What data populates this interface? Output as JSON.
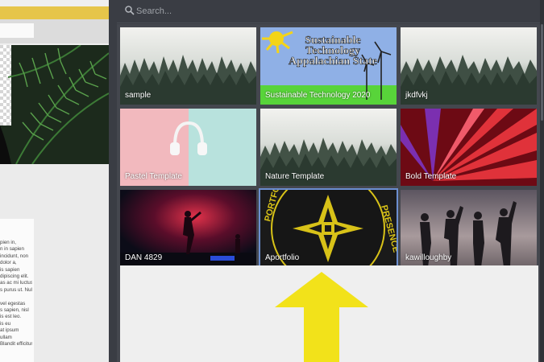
{
  "search": {
    "placeholder": "Search..."
  },
  "left_pane": {
    "body_text": "pien in,\nn in sapien\nincidunt, non\ndolor a,\nis sapien\ndipiscing elit.\nas ac mi luctus\ns purus ut. Nulla\n\nvel egestas\ns sapien, nisl\nis est leo.\nis eu\nat ipsum\nullam\nBlandit efficitur"
  },
  "gallery": {
    "cards": [
      {
        "label": "sample",
        "thumb": "misty-forest"
      },
      {
        "label": "Sustainable Technology 2020",
        "thumb": "wind-turbines",
        "overlay_title": "Sustainable Technology Appalachian State"
      },
      {
        "label": "jkdfvkj",
        "thumb": "misty-forest"
      },
      {
        "label": "Pastel Template",
        "thumb": "headphones-pastel"
      },
      {
        "label": "Nature Template",
        "thumb": "misty-forest"
      },
      {
        "label": "Bold Template",
        "thumb": "red-light-rays"
      },
      {
        "label": "DAN 4829",
        "thumb": "concert-stage"
      },
      {
        "label": "Aportfolio",
        "thumb": "portfolio-presence-logo",
        "logo_text_left": "PORTFOLIO",
        "logo_text_right": "PRESENCE"
      },
      {
        "label": "kawilloughby",
        "thumb": "silhouettes-sky"
      }
    ]
  },
  "annotation": {
    "arrow_color": "#f2e21a",
    "arrow_icon": "up-arrow-icon"
  },
  "colors": {
    "topbar_accent": "#e6c54a",
    "selection": "#6b8fd1",
    "dark_bg": "#3a3d44"
  }
}
